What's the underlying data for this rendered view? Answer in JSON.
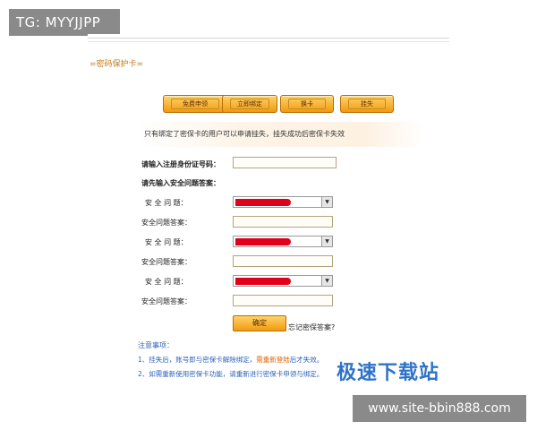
{
  "watermarks": {
    "top_left": "TG: MYYJJPP",
    "bottom_right": "www.site-bbin888.com",
    "logo": "极速下载站"
  },
  "section_title": "=密码保护卡=",
  "tabs": [
    {
      "label": "免费申领"
    },
    {
      "label": "立即绑定"
    },
    {
      "label": "换卡"
    },
    {
      "label": "挂失"
    }
  ],
  "notice": "只有绑定了密保卡的用户可以申请挂失，挂失成功后密保卡失效",
  "form": {
    "id_label": "请输入注册身份证号码：",
    "qa_heading": "请先输入安全问题答案：",
    "rows": [
      {
        "question_label": "安 全 问 题：",
        "answer_label": "安全问题答案："
      },
      {
        "question_label": "安 全 问 题：",
        "answer_label": "安全问题答案："
      },
      {
        "question_label": "安 全 问 题：",
        "answer_label": "安全问题答案："
      }
    ],
    "confirm_label": "确定",
    "forgot_link": "忘记密保答案?"
  },
  "notes": {
    "title": "注意事项：",
    "line1_a": "1、挂失后，账号即与密保卡解除绑定，",
    "line1_hl": "需重新登陆",
    "line1_b": "后才失效。",
    "line2": "2、如需重新使用密保卡功能，请重新进行密保卡申领与绑定。"
  },
  "colors": {
    "accent_orange": "#f19a10",
    "link_blue": "#2b5fb8",
    "redaction_red": "#e0001b"
  }
}
